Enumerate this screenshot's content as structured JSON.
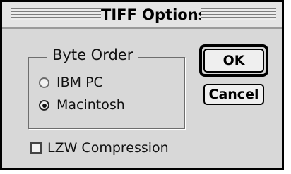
{
  "dialog": {
    "title": "TIFF Options"
  },
  "byte_order": {
    "legend": "Byte Order",
    "options": [
      {
        "label": "IBM PC",
        "selected": false
      },
      {
        "label": "Macintosh",
        "selected": true
      }
    ]
  },
  "buttons": {
    "ok_label": "OK",
    "cancel_label": "Cancel"
  },
  "lzw": {
    "label": "LZW Compression",
    "checked": false
  }
}
